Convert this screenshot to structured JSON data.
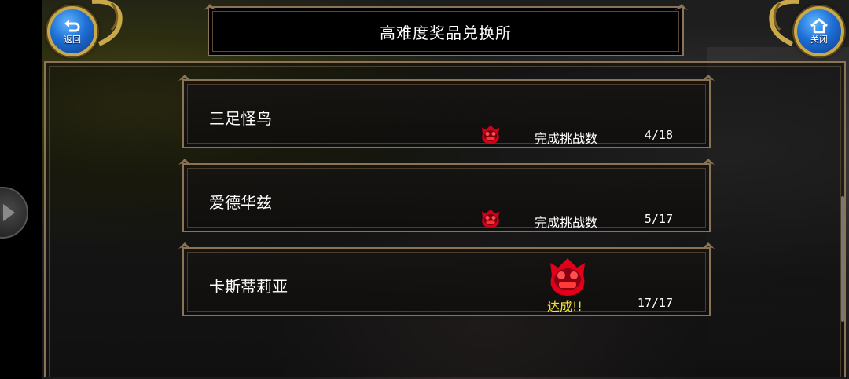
{
  "header": {
    "title": "高难度奖品兑换所",
    "back_label": "返回",
    "close_label": "关闭"
  },
  "colors": {
    "frame": "#8b7355",
    "button_blue": "#1e6fd6",
    "emblem_red": "#e0001a",
    "achieved_yellow": "#f2e23a"
  },
  "challenges": [
    {
      "name": "三足怪鸟",
      "progress_label": "完成挑战数",
      "count": "4/18",
      "completed": 4,
      "total": 18
    },
    {
      "name": "爱德华兹",
      "progress_label": "完成挑战数",
      "count": "5/17",
      "completed": 5,
      "total": 17
    },
    {
      "name": "卡斯蒂莉亚",
      "status": "达成!!",
      "count": "17/17",
      "completed": 17,
      "total": 17
    }
  ],
  "icons": {
    "back": "back-arrow-icon",
    "close": "home-icon",
    "emblem": "demon-face-emblem-icon"
  }
}
